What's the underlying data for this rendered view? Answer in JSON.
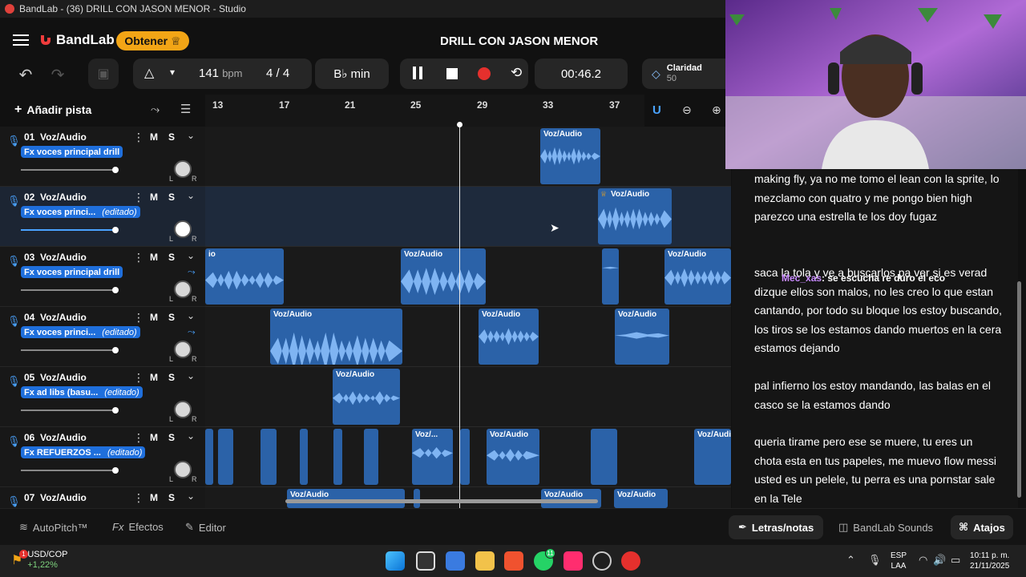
{
  "window": {
    "title": "BandLab - (36) DRILL CON JASON MENOR - Studio"
  },
  "header": {
    "brand": "BandLab",
    "obtener_label": "Obtener",
    "project_title": "DRILL CON JASON MENOR"
  },
  "toolbar": {
    "tempo": "141",
    "tempo_unit": "bpm",
    "time_sig_num": "4",
    "time_sig_den": "4",
    "key": "B♭ min",
    "time": "00:46.2",
    "claridad_label": "Claridad",
    "claridad_value": "50",
    "add_track_label": "Añadir pista"
  },
  "ruler": {
    "labels": [
      "13",
      "17",
      "21",
      "25",
      "29",
      "33",
      "37"
    ]
  },
  "tracks": [
    {
      "num": "01",
      "name": "Voz/Audio",
      "fx": "Fx voces principal drill",
      "edited": ""
    },
    {
      "num": "02",
      "name": "Voz/Audio",
      "fx": "Fx voces princi...",
      "edited": "(editado)"
    },
    {
      "num": "03",
      "name": "Voz/Audio",
      "fx": "Fx voces principal drill",
      "edited": ""
    },
    {
      "num": "04",
      "name": "Voz/Audio",
      "fx": "Fx voces princi...",
      "edited": "(editado)"
    },
    {
      "num": "05",
      "name": "Voz/Audio",
      "fx": "Fx ad libs (basu...",
      "edited": "(editado)"
    },
    {
      "num": "06",
      "name": "Voz/Audio",
      "fx": "Fx REFUERZOS ...",
      "edited": "(editado)"
    },
    {
      "num": "07",
      "name": "Voz/Audio",
      "fx": "",
      "edited": ""
    }
  ],
  "mute_label": "M",
  "solo_label": "S",
  "pan_left": "L",
  "pan_right": "R",
  "clips": {
    "label": "Voz/Audio",
    "short_label": "Voz/...",
    "partial_label": "io"
  },
  "bottombar": {
    "autopitch": "AutoPitch™",
    "efectos": "Efectos",
    "editor": "Editor",
    "letras": "Letras/notas",
    "sounds": "BandLab Sounds",
    "atajos": "Atajos"
  },
  "lyrics": {
    "p1": "making fly, ya no me tomo el lean con la sprite, lo mezclamo con quatro y me pongo bien high parezco una estrella te los doy fugaz",
    "p2": "saca la tola y ve a buscarlos pa ver si es verad dizque ellos son malos, no les creo lo que estan cantando, por todo su bloque los estoy buscando, los tiros se los estamos dando muertos en la cera estamos dejando",
    "p3": "pal infierno los estoy mandando, las balas en el casco se la estamos dando",
    "p4": "queria tirame pero ese se muere, tu eres un chota esta en tus papeles, me muevo flow messi usted es un pelele, tu perra es una pornstar  sale en la Tele"
  },
  "chat": {
    "user": "Mec_xas",
    "message": ": se escucha re duro el eco"
  },
  "taskbar": {
    "ticker": "USD/COP",
    "change": "+1,22%",
    "badge": "1",
    "whatsapp_badge": "11",
    "lang": "ESP",
    "region": "LAA",
    "clock_time": "10:11 p. m.",
    "clock_date": "21/11/2025"
  },
  "colors": {
    "accent": "#1f6fdc",
    "clip": "#2b62a8",
    "record": "#e5302d",
    "obtener": "#f2a516"
  }
}
